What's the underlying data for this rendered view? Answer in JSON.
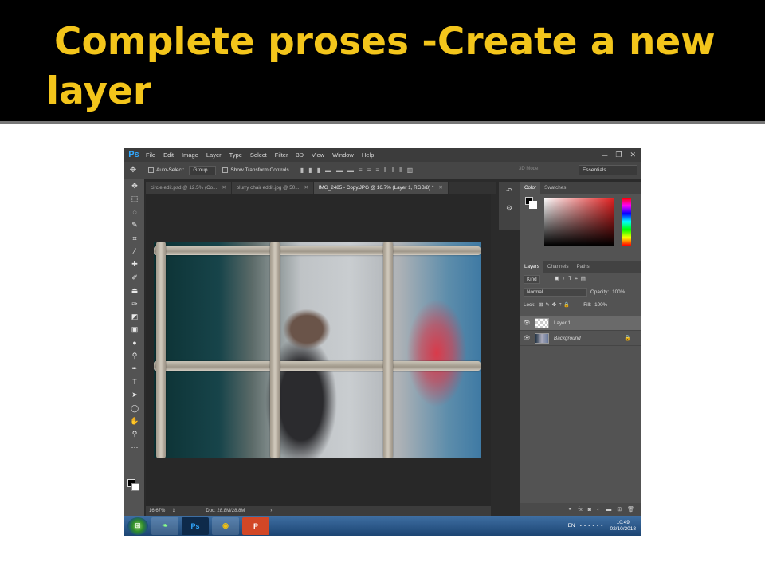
{
  "slide": {
    "title": "Complete proses -Create a new layer"
  },
  "app": {
    "logo": "Ps",
    "menu": [
      "File",
      "Edit",
      "Image",
      "Layer",
      "Type",
      "Select",
      "Filter",
      "3D",
      "View",
      "Window",
      "Help"
    ],
    "window_controls": [
      "─",
      "❐",
      "✕"
    ]
  },
  "options_bar": {
    "auto_select_label": "Auto-Select:",
    "auto_select_value": "Group",
    "show_transform_label": "Show Transform Controls",
    "mode_3d_label": "3D Mode:",
    "workspace": "Essentials"
  },
  "tabs": [
    {
      "label": "circle edit.psd @ 12.5% (Co...",
      "close": "✕"
    },
    {
      "label": "blurry chair eddit.jpg @ 50...",
      "close": "✕"
    },
    {
      "label": "IMG_2485 - Copy.JPG @ 16.7% (Layer 1, RGB/8) *",
      "close": "✕"
    }
  ],
  "status": {
    "zoom": "16.67%",
    "doc_size": "Doc: 28.8M/28.8M"
  },
  "color_panel": {
    "tabs": [
      "Color",
      "Swatches"
    ],
    "accent": "#e21f1f"
  },
  "layers_panel": {
    "tabs": [
      "Layers",
      "Channels",
      "Paths"
    ],
    "kind_filter": "Kind",
    "blend_mode": "Normal",
    "opacity_label": "Opacity:",
    "opacity_value": "100%",
    "lock_label": "Lock:",
    "fill_label": "Fill:",
    "fill_value": "100%",
    "layers": [
      {
        "name": "Layer 1",
        "selected": true
      },
      {
        "name": "Background",
        "locked": true
      }
    ]
  },
  "taskbar": {
    "language": "EN",
    "time": "10:49",
    "date": "02/10/2018",
    "apps": [
      "Ps",
      "Chrome",
      "PowerPoint"
    ]
  }
}
